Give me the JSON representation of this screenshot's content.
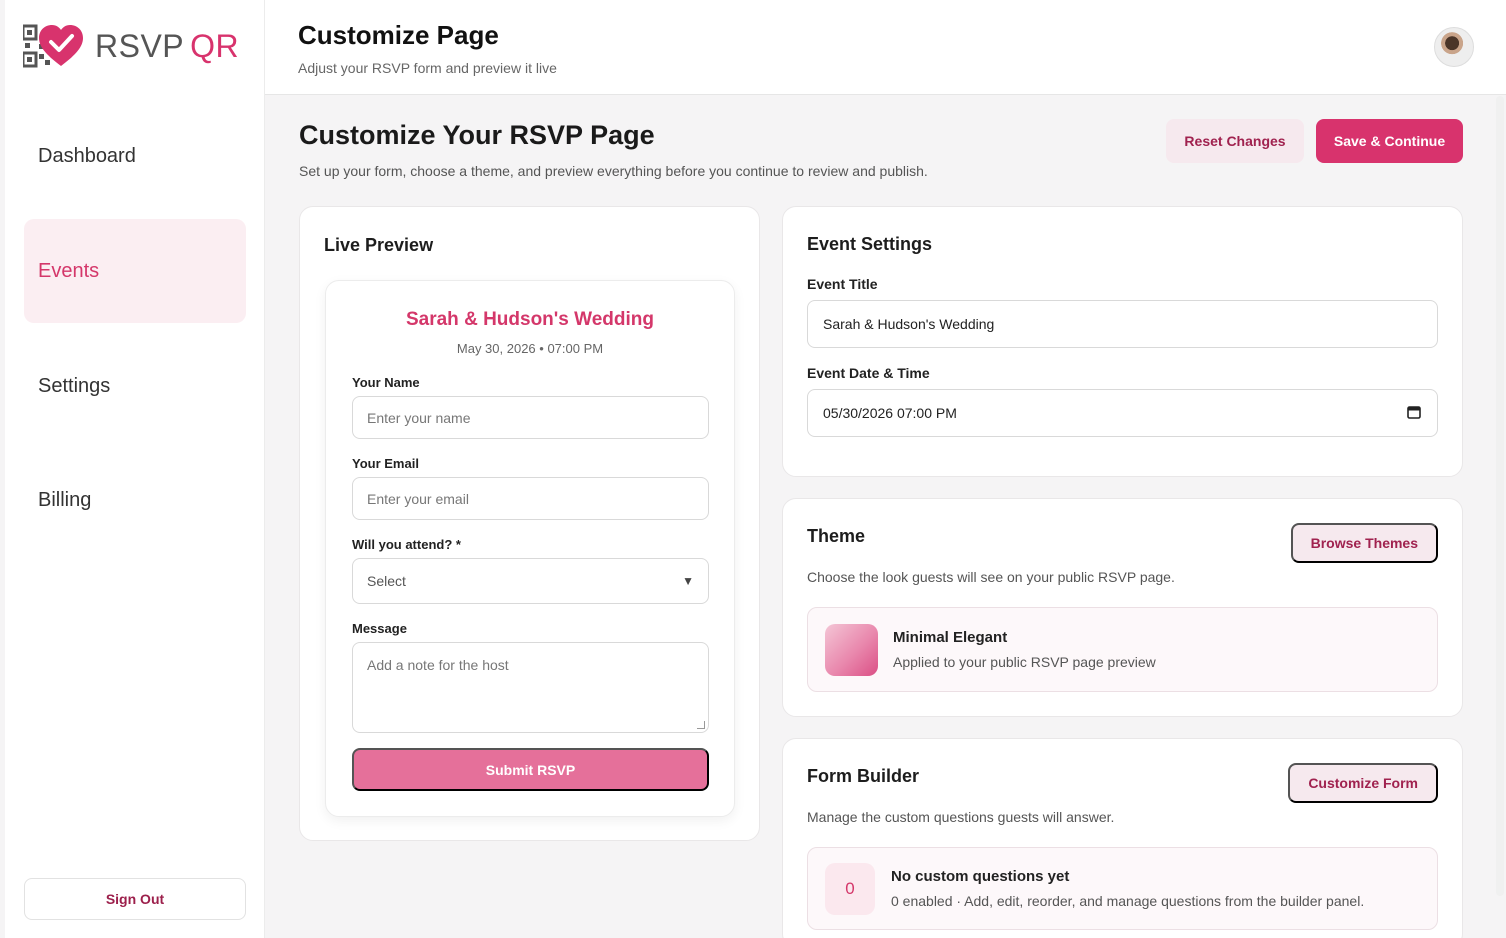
{
  "brand": {
    "name_part1": "RSVP",
    "name_part2": "QR"
  },
  "sidebar": {
    "items": [
      {
        "label": "Dashboard"
      },
      {
        "label": "Events"
      },
      {
        "label": "Settings"
      },
      {
        "label": "Billing"
      }
    ],
    "signout_label": "Sign Out"
  },
  "header": {
    "title": "Customize Page",
    "subtitle": "Adjust your RSVP form and preview it live"
  },
  "main": {
    "title": "Customize Your RSVP Page",
    "subtitle": "Set up your form, choose a theme, and preview everything before you continue to review and publish.",
    "reset_label": "Reset Changes",
    "save_label": "Save & Continue"
  },
  "preview": {
    "heading": "Live Preview",
    "event_title": "Sarah & Hudson's Wedding",
    "event_date": "May 30, 2026 • 07:00 PM",
    "name_label": "Your Name",
    "name_placeholder": "Enter your name",
    "email_label": "Your Email",
    "email_placeholder": "Enter your email",
    "attend_label": "Will you attend? *",
    "attend_value": "Select",
    "message_label": "Message",
    "message_placeholder": "Add a note for the host",
    "submit_label": "Submit RSVP"
  },
  "event_settings": {
    "heading": "Event Settings",
    "title_label": "Event Title",
    "title_value": "Sarah & Hudson's Wedding",
    "datetime_label": "Event Date & Time",
    "datetime_value": "05/30/2026 07:00 PM"
  },
  "theme": {
    "heading": "Theme",
    "browse_label": "Browse Themes",
    "description": "Choose the look guests will see on your public RSVP page.",
    "selected_name": "Minimal Elegant",
    "selected_desc": "Applied to your public RSVP page preview"
  },
  "form_builder": {
    "heading": "Form Builder",
    "customize_label": "Customize Form",
    "description": "Manage the custom questions guests will answer.",
    "count": "0",
    "empty_title": "No custom questions yet",
    "empty_desc": "0 enabled · Add, edit, reorder, and manage questions from the builder panel."
  },
  "colors": {
    "accent": "#d8336d",
    "accent_soft": "#f6e9ee",
    "submit": "#e5709a"
  },
  "icons": {
    "logo": "qr-heart-icon",
    "calendar": "calendar-icon",
    "dropdown": "caret-down-icon"
  }
}
